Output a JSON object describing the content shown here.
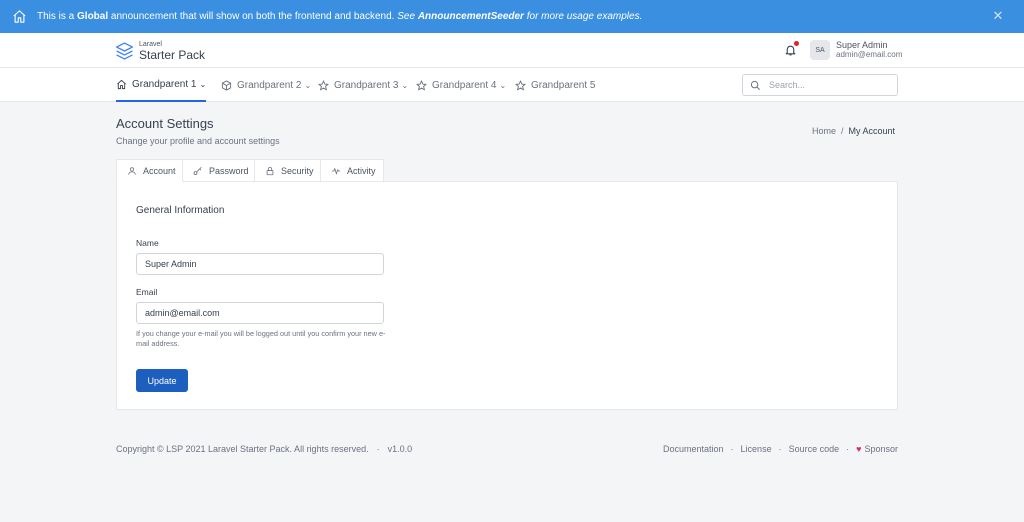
{
  "announcement": {
    "prefix": "This is a ",
    "bold": "Global",
    "middle": " announcement that will show on both the frontend and backend. ",
    "italic_see": "See ",
    "italic_bold": "AnnouncementSeeder",
    "italic_rest": " for more usage examples.",
    "close": "✕"
  },
  "brand": {
    "small": "Laravel",
    "big": "Starter Pack"
  },
  "user": {
    "initials": "SA",
    "name": "Super Admin",
    "email": "admin@email.com"
  },
  "nav": {
    "items": [
      {
        "label": "Grandparent 1",
        "chev": "⌄"
      },
      {
        "label": "Grandparent 2",
        "chev": "⌄"
      },
      {
        "label": "Grandparent 3",
        "chev": "⌄"
      },
      {
        "label": "Grandparent 4",
        "chev": "⌄"
      },
      {
        "label": "Grandparent 5"
      }
    ],
    "search_placeholder": "Search..."
  },
  "page": {
    "title": "Account Settings",
    "subtitle": "Change your profile and account settings"
  },
  "breadcrumb": {
    "home": "Home",
    "sep": "/",
    "current": "My Account"
  },
  "tabs": [
    {
      "label": "Account"
    },
    {
      "label": "Password"
    },
    {
      "label": "Security"
    },
    {
      "label": "Activity"
    }
  ],
  "form": {
    "section_title": "General Information",
    "name_label": "Name",
    "name_value": "Super Admin",
    "email_label": "Email",
    "email_value": "admin@email.com",
    "help": "If you change your e-mail you will be logged out until you confirm your new e-mail address.",
    "submit": "Update"
  },
  "footer": {
    "copyright": "Copyright © LSP 2021 Laravel Starter Pack. All rights reserved.",
    "dot": "·",
    "version": "v1.0.0",
    "links": [
      "Documentation",
      "License",
      "Source code",
      "Sponsor"
    ],
    "heart": "♥"
  },
  "colors": {
    "announcement_bg": "#3b8fe0",
    "primary": "#1d5fbf",
    "active_underline": "#2563eb",
    "notification_dot": "#dc2626",
    "heart": "#db2777"
  }
}
